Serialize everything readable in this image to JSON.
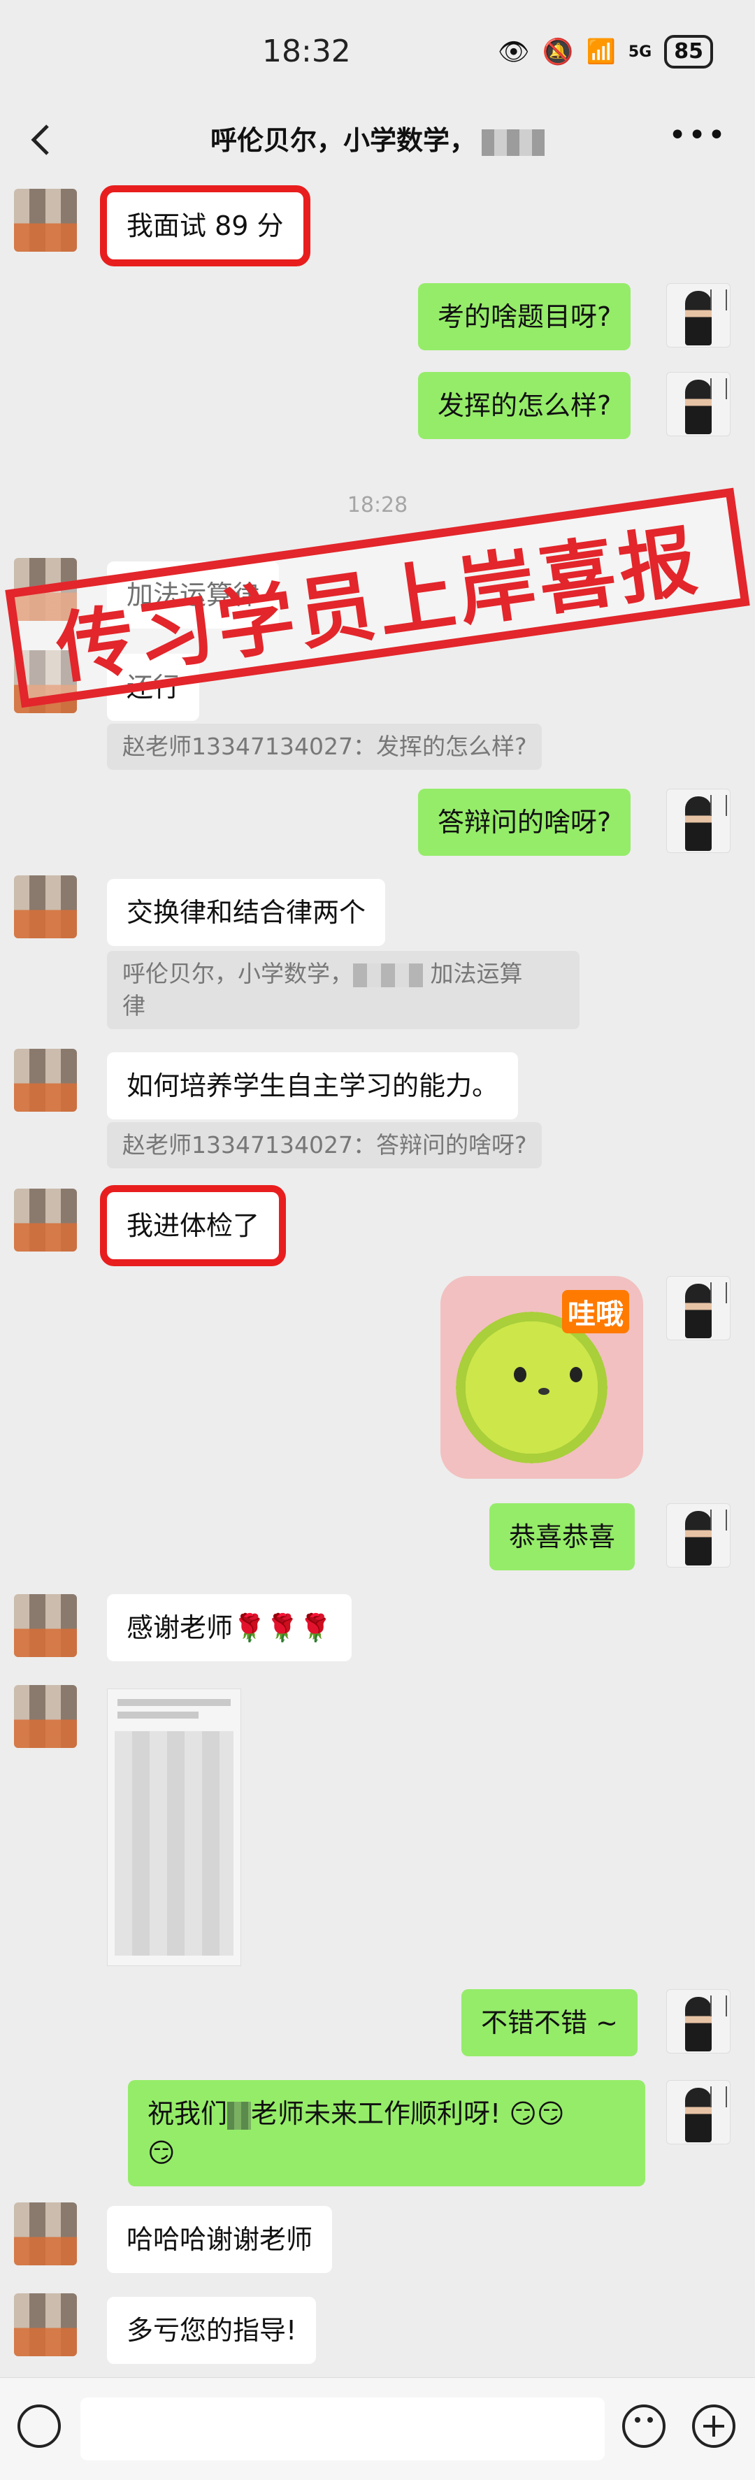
{
  "status": {
    "time": "18:32",
    "network": "5G",
    "battery": "85"
  },
  "nav": {
    "title": "呼伦贝尔，小学数学，"
  },
  "timestamp": "18:28",
  "banner": "传习学员上岸喜报",
  "sticker_text": "哇哦",
  "messages": [
    {
      "text": "我面试 89 分"
    },
    {
      "text": "考的啥题目呀?"
    },
    {
      "text": "发挥的怎么样?"
    },
    {
      "text": "加法运算律"
    },
    {
      "text": "还行"
    },
    {
      "text": "赵老师13347134027：发挥的怎么样?"
    },
    {
      "text": "答辩问的啥呀?"
    },
    {
      "text": "交换律和结合律两个"
    },
    {
      "text": "呼伦贝尔，小学数学，"
    },
    {
      "text": "加法运算"
    },
    {
      "text": "律"
    },
    {
      "text": "如何培养学生自主学习的能力。"
    },
    {
      "text": "赵老师13347134027：答辩问的啥呀?"
    },
    {
      "text": "我进体检了"
    },
    {
      "text": "恭喜恭喜"
    },
    {
      "text": "感谢老师🌹🌹🌹"
    },
    {
      "text": "不错不错 ~"
    },
    {
      "text": "祝我们"
    },
    {
      "text": "老师未来工作顺利呀! 😏😏"
    },
    {
      "text": "😏"
    },
    {
      "text": "哈哈哈谢谢老师"
    },
    {
      "text": "多亏您的指导!"
    }
  ]
}
